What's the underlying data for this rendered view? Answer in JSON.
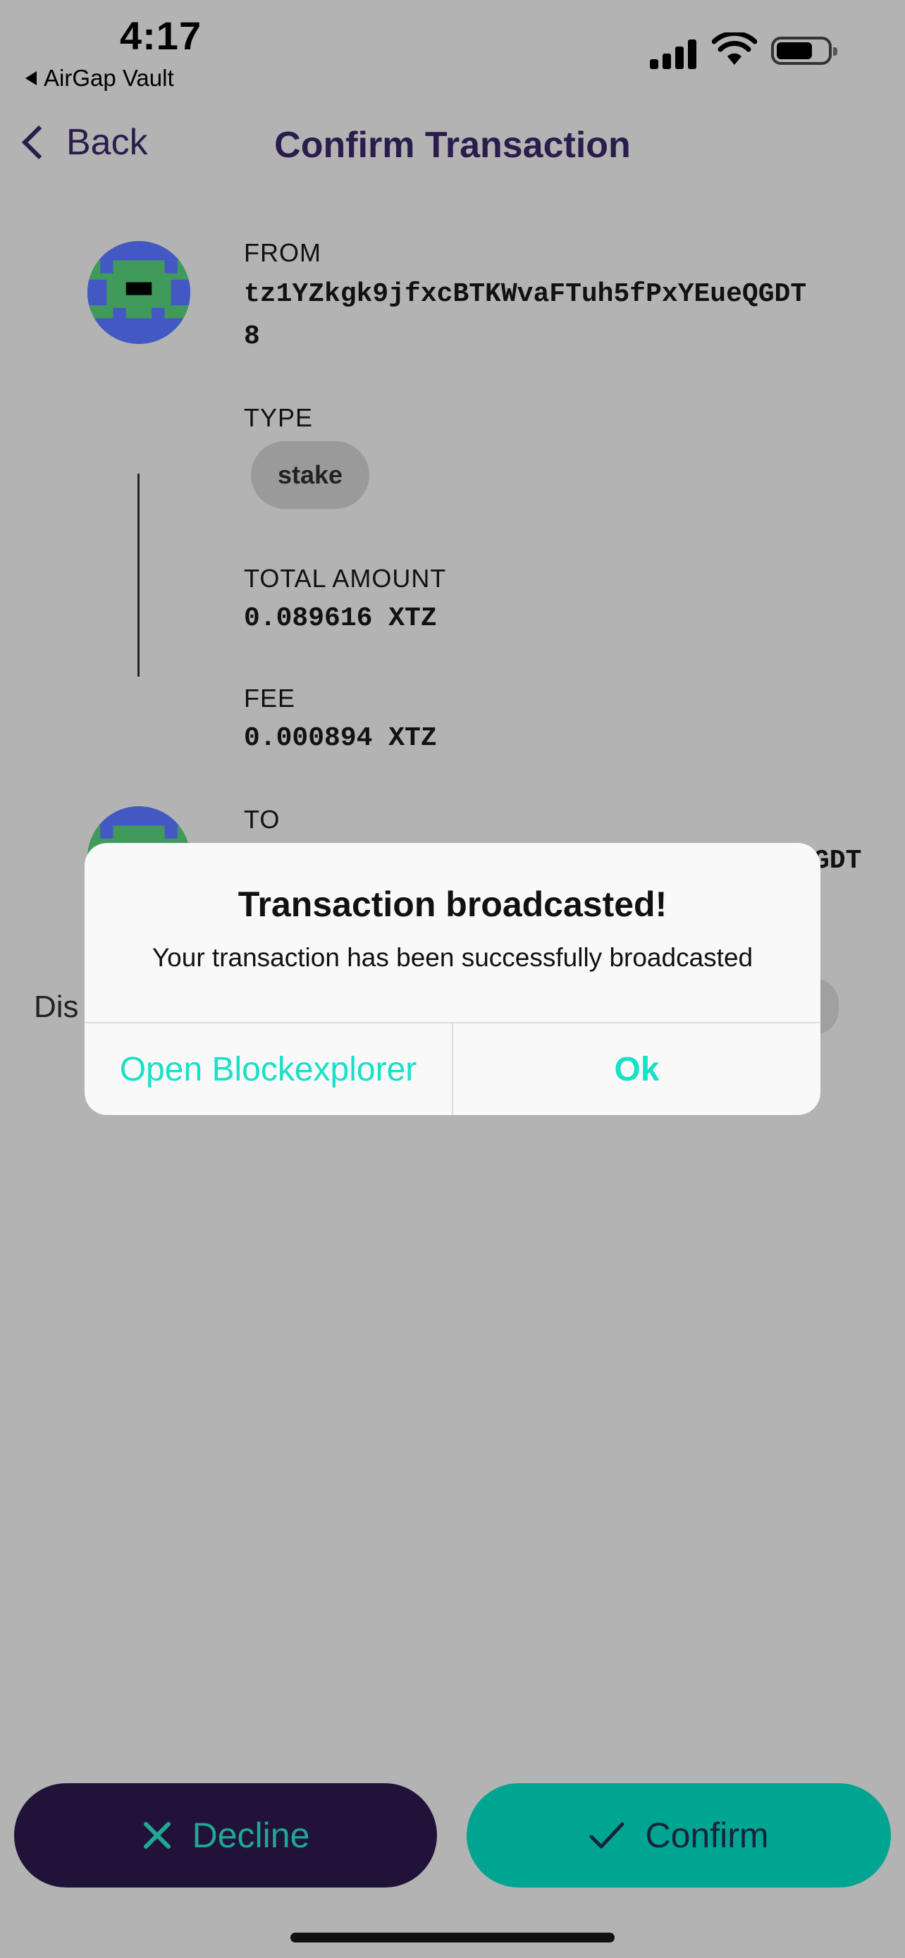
{
  "status_bar": {
    "time": "4:17",
    "back_app_label": "AirGap Vault"
  },
  "nav": {
    "back_label": "Back",
    "title": "Confirm Transaction"
  },
  "transaction": {
    "from_label": "FROM",
    "from_address_line1": "tz1YZkgk9jfxcBTKWvaFTuh5fPxYEueQGDT",
    "from_address_line2": "8",
    "type_label": "TYPE",
    "type_value": "stake",
    "total_amount_label": "TOTAL AMOUNT",
    "total_amount_value": "0.089616 XTZ",
    "fee_label": "FEE",
    "fee_value": "0.000894 XTZ",
    "to_label": "TO",
    "to_address_visible_tail": "GDT"
  },
  "background_partial_text": "Dis",
  "dialog": {
    "title": "Transaction broadcasted!",
    "message": "Your transaction has been successfully broadcasted",
    "left_button": "Open Blockexplorer",
    "right_button": "Ok"
  },
  "actions": {
    "decline_label": "Decline",
    "confirm_label": "Confirm"
  },
  "colors": {
    "accent_teal": "#19e0c8",
    "decline_bg": "#21123a",
    "confirm_bg": "#00a591",
    "nav_text": "#2a1d4c",
    "overlay_bg": "#b3b3b3"
  }
}
